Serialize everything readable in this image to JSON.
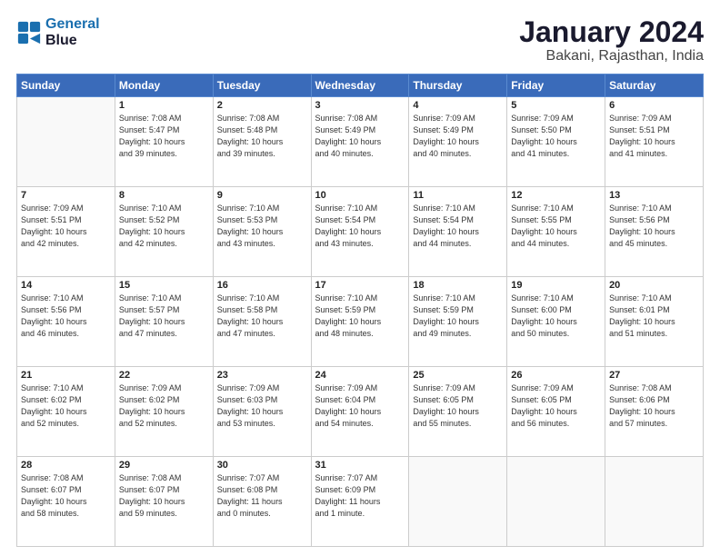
{
  "header": {
    "logo_line1": "General",
    "logo_line2": "Blue",
    "title": "January 2024",
    "subtitle": "Bakani, Rajasthan, India"
  },
  "days_of_week": [
    "Sunday",
    "Monday",
    "Tuesday",
    "Wednesday",
    "Thursday",
    "Friday",
    "Saturday"
  ],
  "weeks": [
    [
      {
        "day": "",
        "info": ""
      },
      {
        "day": "1",
        "info": "Sunrise: 7:08 AM\nSunset: 5:47 PM\nDaylight: 10 hours\nand 39 minutes."
      },
      {
        "day": "2",
        "info": "Sunrise: 7:08 AM\nSunset: 5:48 PM\nDaylight: 10 hours\nand 39 minutes."
      },
      {
        "day": "3",
        "info": "Sunrise: 7:08 AM\nSunset: 5:49 PM\nDaylight: 10 hours\nand 40 minutes."
      },
      {
        "day": "4",
        "info": "Sunrise: 7:09 AM\nSunset: 5:49 PM\nDaylight: 10 hours\nand 40 minutes."
      },
      {
        "day": "5",
        "info": "Sunrise: 7:09 AM\nSunset: 5:50 PM\nDaylight: 10 hours\nand 41 minutes."
      },
      {
        "day": "6",
        "info": "Sunrise: 7:09 AM\nSunset: 5:51 PM\nDaylight: 10 hours\nand 41 minutes."
      }
    ],
    [
      {
        "day": "7",
        "info": "Sunrise: 7:09 AM\nSunset: 5:51 PM\nDaylight: 10 hours\nand 42 minutes."
      },
      {
        "day": "8",
        "info": "Sunrise: 7:10 AM\nSunset: 5:52 PM\nDaylight: 10 hours\nand 42 minutes."
      },
      {
        "day": "9",
        "info": "Sunrise: 7:10 AM\nSunset: 5:53 PM\nDaylight: 10 hours\nand 43 minutes."
      },
      {
        "day": "10",
        "info": "Sunrise: 7:10 AM\nSunset: 5:54 PM\nDaylight: 10 hours\nand 43 minutes."
      },
      {
        "day": "11",
        "info": "Sunrise: 7:10 AM\nSunset: 5:54 PM\nDaylight: 10 hours\nand 44 minutes."
      },
      {
        "day": "12",
        "info": "Sunrise: 7:10 AM\nSunset: 5:55 PM\nDaylight: 10 hours\nand 44 minutes."
      },
      {
        "day": "13",
        "info": "Sunrise: 7:10 AM\nSunset: 5:56 PM\nDaylight: 10 hours\nand 45 minutes."
      }
    ],
    [
      {
        "day": "14",
        "info": "Sunrise: 7:10 AM\nSunset: 5:56 PM\nDaylight: 10 hours\nand 46 minutes."
      },
      {
        "day": "15",
        "info": "Sunrise: 7:10 AM\nSunset: 5:57 PM\nDaylight: 10 hours\nand 47 minutes."
      },
      {
        "day": "16",
        "info": "Sunrise: 7:10 AM\nSunset: 5:58 PM\nDaylight: 10 hours\nand 47 minutes."
      },
      {
        "day": "17",
        "info": "Sunrise: 7:10 AM\nSunset: 5:59 PM\nDaylight: 10 hours\nand 48 minutes."
      },
      {
        "day": "18",
        "info": "Sunrise: 7:10 AM\nSunset: 5:59 PM\nDaylight: 10 hours\nand 49 minutes."
      },
      {
        "day": "19",
        "info": "Sunrise: 7:10 AM\nSunset: 6:00 PM\nDaylight: 10 hours\nand 50 minutes."
      },
      {
        "day": "20",
        "info": "Sunrise: 7:10 AM\nSunset: 6:01 PM\nDaylight: 10 hours\nand 51 minutes."
      }
    ],
    [
      {
        "day": "21",
        "info": "Sunrise: 7:10 AM\nSunset: 6:02 PM\nDaylight: 10 hours\nand 52 minutes."
      },
      {
        "day": "22",
        "info": "Sunrise: 7:09 AM\nSunset: 6:02 PM\nDaylight: 10 hours\nand 52 minutes."
      },
      {
        "day": "23",
        "info": "Sunrise: 7:09 AM\nSunset: 6:03 PM\nDaylight: 10 hours\nand 53 minutes."
      },
      {
        "day": "24",
        "info": "Sunrise: 7:09 AM\nSunset: 6:04 PM\nDaylight: 10 hours\nand 54 minutes."
      },
      {
        "day": "25",
        "info": "Sunrise: 7:09 AM\nSunset: 6:05 PM\nDaylight: 10 hours\nand 55 minutes."
      },
      {
        "day": "26",
        "info": "Sunrise: 7:09 AM\nSunset: 6:05 PM\nDaylight: 10 hours\nand 56 minutes."
      },
      {
        "day": "27",
        "info": "Sunrise: 7:08 AM\nSunset: 6:06 PM\nDaylight: 10 hours\nand 57 minutes."
      }
    ],
    [
      {
        "day": "28",
        "info": "Sunrise: 7:08 AM\nSunset: 6:07 PM\nDaylight: 10 hours\nand 58 minutes."
      },
      {
        "day": "29",
        "info": "Sunrise: 7:08 AM\nSunset: 6:07 PM\nDaylight: 10 hours\nand 59 minutes."
      },
      {
        "day": "30",
        "info": "Sunrise: 7:07 AM\nSunset: 6:08 PM\nDaylight: 11 hours\nand 0 minutes."
      },
      {
        "day": "31",
        "info": "Sunrise: 7:07 AM\nSunset: 6:09 PM\nDaylight: 11 hours\nand 1 minute."
      },
      {
        "day": "",
        "info": ""
      },
      {
        "day": "",
        "info": ""
      },
      {
        "day": "",
        "info": ""
      }
    ]
  ]
}
